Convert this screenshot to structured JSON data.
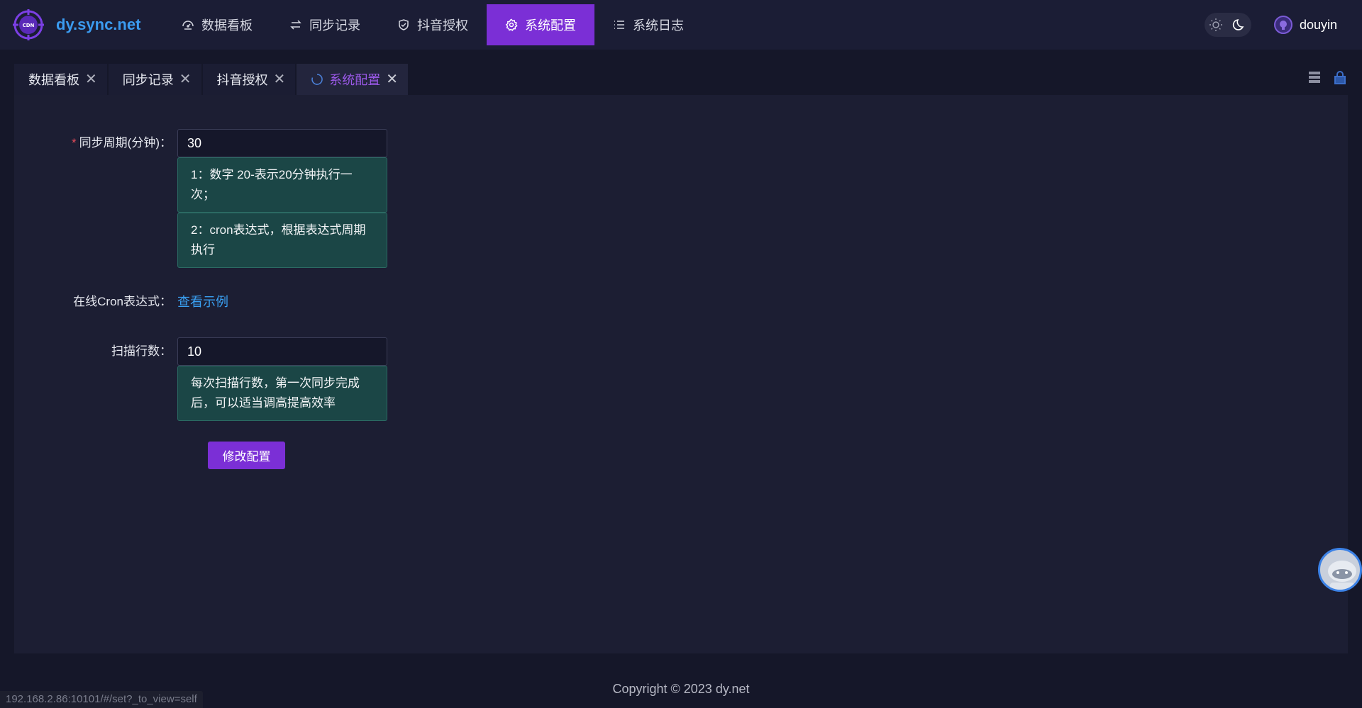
{
  "header": {
    "app_name": "dy.sync.net",
    "logo_text": "CDN",
    "nav": [
      {
        "label": "数据看板",
        "icon": "dashboard-icon"
      },
      {
        "label": "同步记录",
        "icon": "swap-icon"
      },
      {
        "label": "抖音授权",
        "icon": "shield-icon"
      },
      {
        "label": "系统配置",
        "icon": "gear-icon",
        "active": true
      },
      {
        "label": "系统日志",
        "icon": "list-icon"
      }
    ],
    "user_name": "douyin"
  },
  "tabs": [
    {
      "label": "数据看板"
    },
    {
      "label": "同步记录"
    },
    {
      "label": "抖音授权"
    },
    {
      "label": "系统配置",
      "active": true
    }
  ],
  "form": {
    "sync_period": {
      "label": "同步周期(分钟)：",
      "required_mark": "*",
      "value": "30",
      "hints": [
        "1：数字 20-表示20分钟执行一次；",
        "2：cron表达式，根据表达式周期执行"
      ]
    },
    "cron": {
      "label": "在线Cron表达式：",
      "link_text": "查看示例"
    },
    "scan_rows": {
      "label": "扫描行数：",
      "value": "10",
      "hint": "每次扫描行数，第一次同步完成后，可以适当调高提高效率"
    },
    "submit_label": "修改配置"
  },
  "footer": {
    "copyright": "Copyright © 2023 dy.net"
  },
  "status_url": "192.168.2.86:10101/#/set?_to_view=self",
  "colors": {
    "accent": "#7b2fd6",
    "link": "#3aa0f2",
    "hint_bg": "#1b4646",
    "background": "#151729"
  }
}
